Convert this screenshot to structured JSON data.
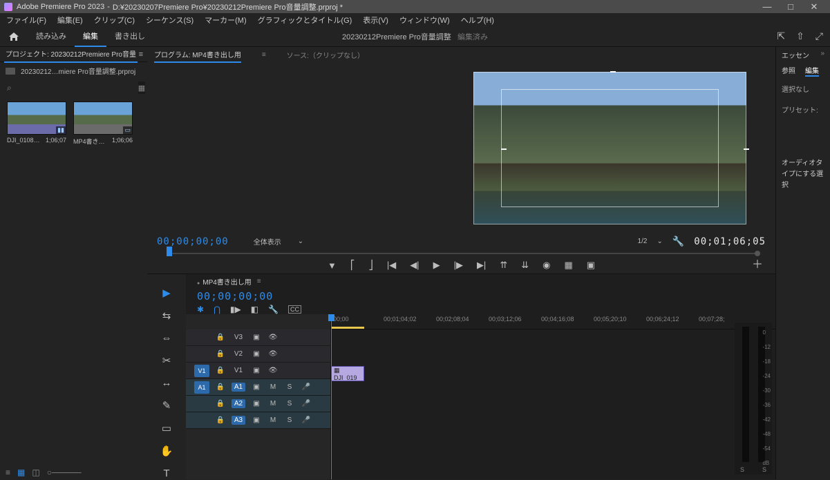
{
  "titlebar": {
    "app": "Adobe Premiere Pro 2023",
    "path": "D:¥20230207Premiere Pro¥20230212Premiere Pro音量調整.prproj *"
  },
  "menu": [
    "ファイル(F)",
    "編集(E)",
    "クリップ(C)",
    "シーケンス(S)",
    "マーカー(M)",
    "グラフィックとタイトル(G)",
    "表示(V)",
    "ウィンドウ(W)",
    "ヘルプ(H)"
  ],
  "workspace": {
    "tabs": [
      "読み込み",
      "編集",
      "書き出し"
    ],
    "active": 1,
    "project_name": "20230212Premiere Pro音量調整",
    "status": "編集済み"
  },
  "project_panel": {
    "tab": "プロジェクト: 20230212Premiere Pro音量",
    "breadcrumb": "20230212…miere Pro音量調整.prproj",
    "search_placeholder": "",
    "bins": [
      {
        "name": "DJI_0108…",
        "dur": "1;06;07"
      },
      {
        "name": "MP4書き…",
        "dur": "1;06;06"
      }
    ]
  },
  "monitor": {
    "tab_program": "プログラム: MP4書き出し用",
    "tab_source": "ソース:（クリップなし）",
    "tc_left": "00;00;00;00",
    "zoom": "全体表示",
    "scale_select": "1/2",
    "tc_right": "00;01;06;05"
  },
  "timeline": {
    "tab": "MP4書き出し用",
    "tc": "00;00;00;00",
    "ruler": [
      "00;00",
      "00;01;04;02",
      "00;02;08;04",
      "00;03;12;06",
      "00;04;16;08",
      "00;05;20;10",
      "00;06;24;12",
      "00;07;28;"
    ],
    "clip_name": "DJI_019",
    "tracks_v": [
      "V3",
      "V2",
      "V1"
    ],
    "tracks_a": [
      "A1",
      "A2",
      "A3"
    ]
  },
  "essentials": {
    "title": "エッセン",
    "subtabs": [
      "参照",
      "編集"
    ],
    "no_selection": "選択なし",
    "preset": "プリセット:",
    "help": "オーディオタイプにする選択"
  },
  "meter_marks": [
    "0",
    "-12",
    "-18",
    "-24",
    "-30",
    "-36",
    "-42",
    "-48",
    "-54",
    "dB"
  ]
}
